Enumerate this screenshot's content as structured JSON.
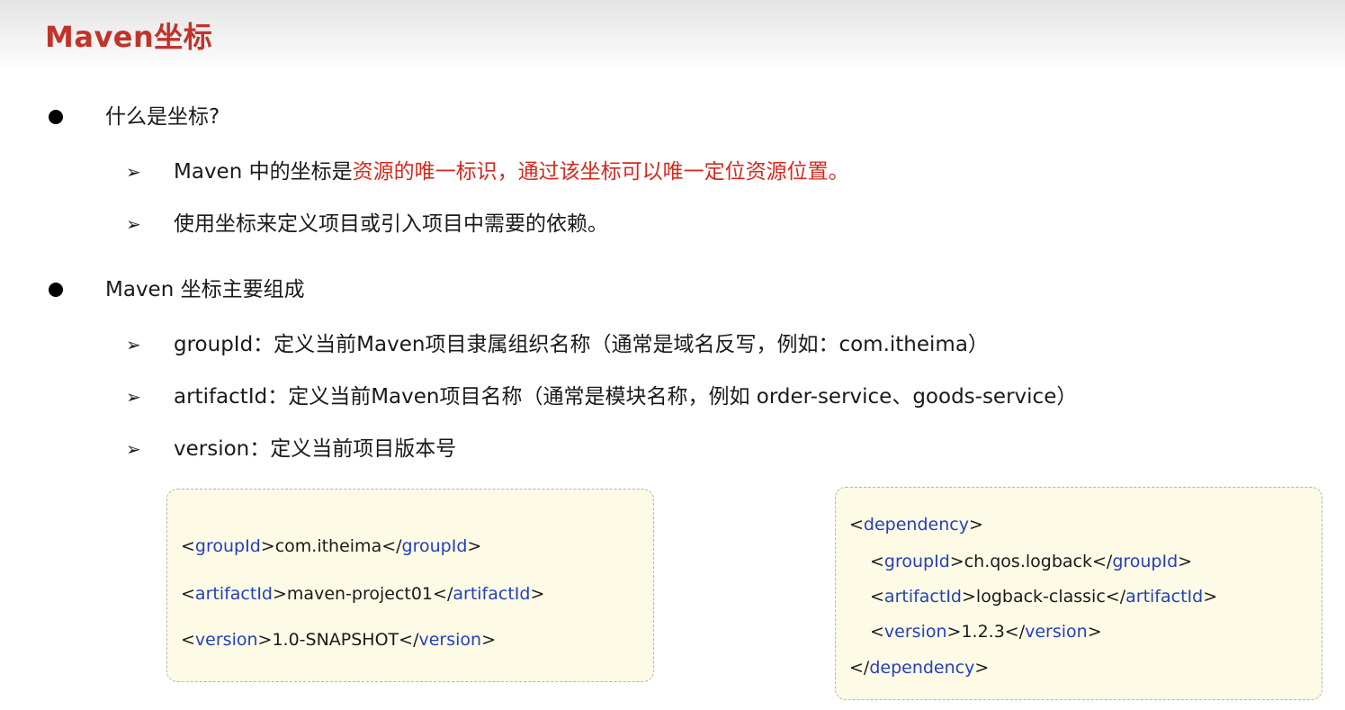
{
  "title": "Maven坐标",
  "colors": {
    "title": "#c0342b",
    "highlight": "#d42a1f",
    "tag": "#2441b8",
    "code_bg": "#fdfae6"
  },
  "bullets": [
    {
      "text": "什么是坐标?",
      "items": [
        {
          "prefix": "Maven 中的坐标是",
          "highlight": "资源的唯一标识，通过该坐标可以唯一定位资源位置。"
        },
        {
          "prefix": "使用坐标来定义项目或引入项目中需要的依赖。",
          "highlight": ""
        }
      ]
    },
    {
      "text": "Maven 坐标主要组成",
      "items": [
        {
          "prefix": "groupId：定义当前Maven项目隶属组织名称（通常是域名反写，例如：com.itheima）",
          "highlight": ""
        },
        {
          "prefix": "artifactId：定义当前Maven项目名称（通常是模块名称，例如 order-service、goods-service）",
          "highlight": ""
        },
        {
          "prefix": "version：定义当前项目版本号",
          "highlight": ""
        }
      ]
    }
  ],
  "code_left": [
    {
      "tag": "groupId",
      "value": "com.itheima"
    },
    {
      "tag": "artifactId",
      "value": "maven-project01"
    },
    {
      "tag": "version",
      "value": "1.0-SNAPSHOT"
    }
  ],
  "code_right": {
    "wrapper": "dependency",
    "lines": [
      {
        "tag": "groupId",
        "value": "ch.qos.logback"
      },
      {
        "tag": "artifactId",
        "value": "logback-classic"
      },
      {
        "tag": "version",
        "value": "1.2.3"
      }
    ]
  }
}
